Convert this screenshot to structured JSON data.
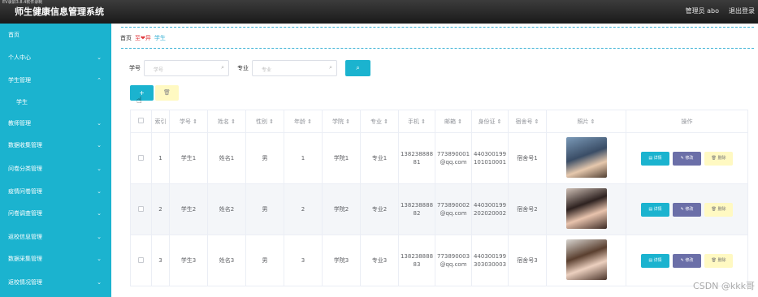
{
  "topbar": {
    "recorder_text": "EV录屏3.8.4软件录制",
    "app_title": "师生健康信息管理系统",
    "admin_label": "管理员 abo",
    "logout_label": "退出登录"
  },
  "sidebar": {
    "items": [
      {
        "label": "首页",
        "chevron": ""
      },
      {
        "label": "个人中心",
        "chevron": "⌄"
      },
      {
        "label": "学生管理",
        "chevron": "⌃"
      },
      {
        "label": "学生",
        "chevron": ""
      },
      {
        "label": "教师管理",
        "chevron": "⌄"
      },
      {
        "label": "数据收集管理",
        "chevron": "⌄"
      },
      {
        "label": "问卷分类管理",
        "chevron": "⌄"
      },
      {
        "label": "疫情问卷管理",
        "chevron": "⌄"
      },
      {
        "label": "问卷调查管理",
        "chevron": "⌄"
      },
      {
        "label": "返校信息管理",
        "chevron": "⌄"
      },
      {
        "label": "数据采集管理",
        "chevron": "⌄"
      },
      {
        "label": "返校情况管理",
        "chevron": "⌄"
      }
    ]
  },
  "breadcrumb": {
    "home": "首页",
    "separator": "至❤异",
    "current": "学生"
  },
  "search": {
    "student_no_label": "学号",
    "student_no_placeholder": "学号",
    "major_label": "专业",
    "major_placeholder": "专业",
    "search_icon": "⌕"
  },
  "toolbar": {
    "add_label": "+",
    "delete_icon": "🗑"
  },
  "table": {
    "headers": [
      "",
      "索引",
      "学号 ⇕",
      "姓名 ⇕",
      "性别 ⇕",
      "年龄 ⇕",
      "学院 ⇕",
      "专业 ⇕",
      "手机 ⇕",
      "邮箱 ⇕",
      "身份证 ⇕",
      "宿舍号 ⇕",
      "照片 ⇕",
      "操作"
    ],
    "rows": [
      {
        "index": "1",
        "student_no": "学生1",
        "name": "姓名1",
        "gender": "男",
        "age": "1",
        "college": "学院1",
        "major": "专业1",
        "phone": "13823888881",
        "email": "773890001@qq.com",
        "id_card": "440300199101010001",
        "dorm": "宿舍号1"
      },
      {
        "index": "2",
        "student_no": "学生2",
        "name": "姓名2",
        "gender": "男",
        "age": "2",
        "college": "学院2",
        "major": "专业2",
        "phone": "13823888882",
        "email": "773890002@qq.com",
        "id_card": "440300199202020002",
        "dorm": "宿舍号2"
      },
      {
        "index": "3",
        "student_no": "学生3",
        "name": "姓名3",
        "gender": "男",
        "age": "3",
        "college": "学院3",
        "major": "专业3",
        "phone": "13823888883",
        "email": "773890003@qq.com",
        "id_card": "440300199303030003",
        "dorm": "宿舍号3"
      }
    ],
    "actions": {
      "detail": "▤ 详情",
      "edit": "✎ 修改",
      "delete": "🗑 删除"
    }
  },
  "watermark": "CSDN @kkk哥"
}
